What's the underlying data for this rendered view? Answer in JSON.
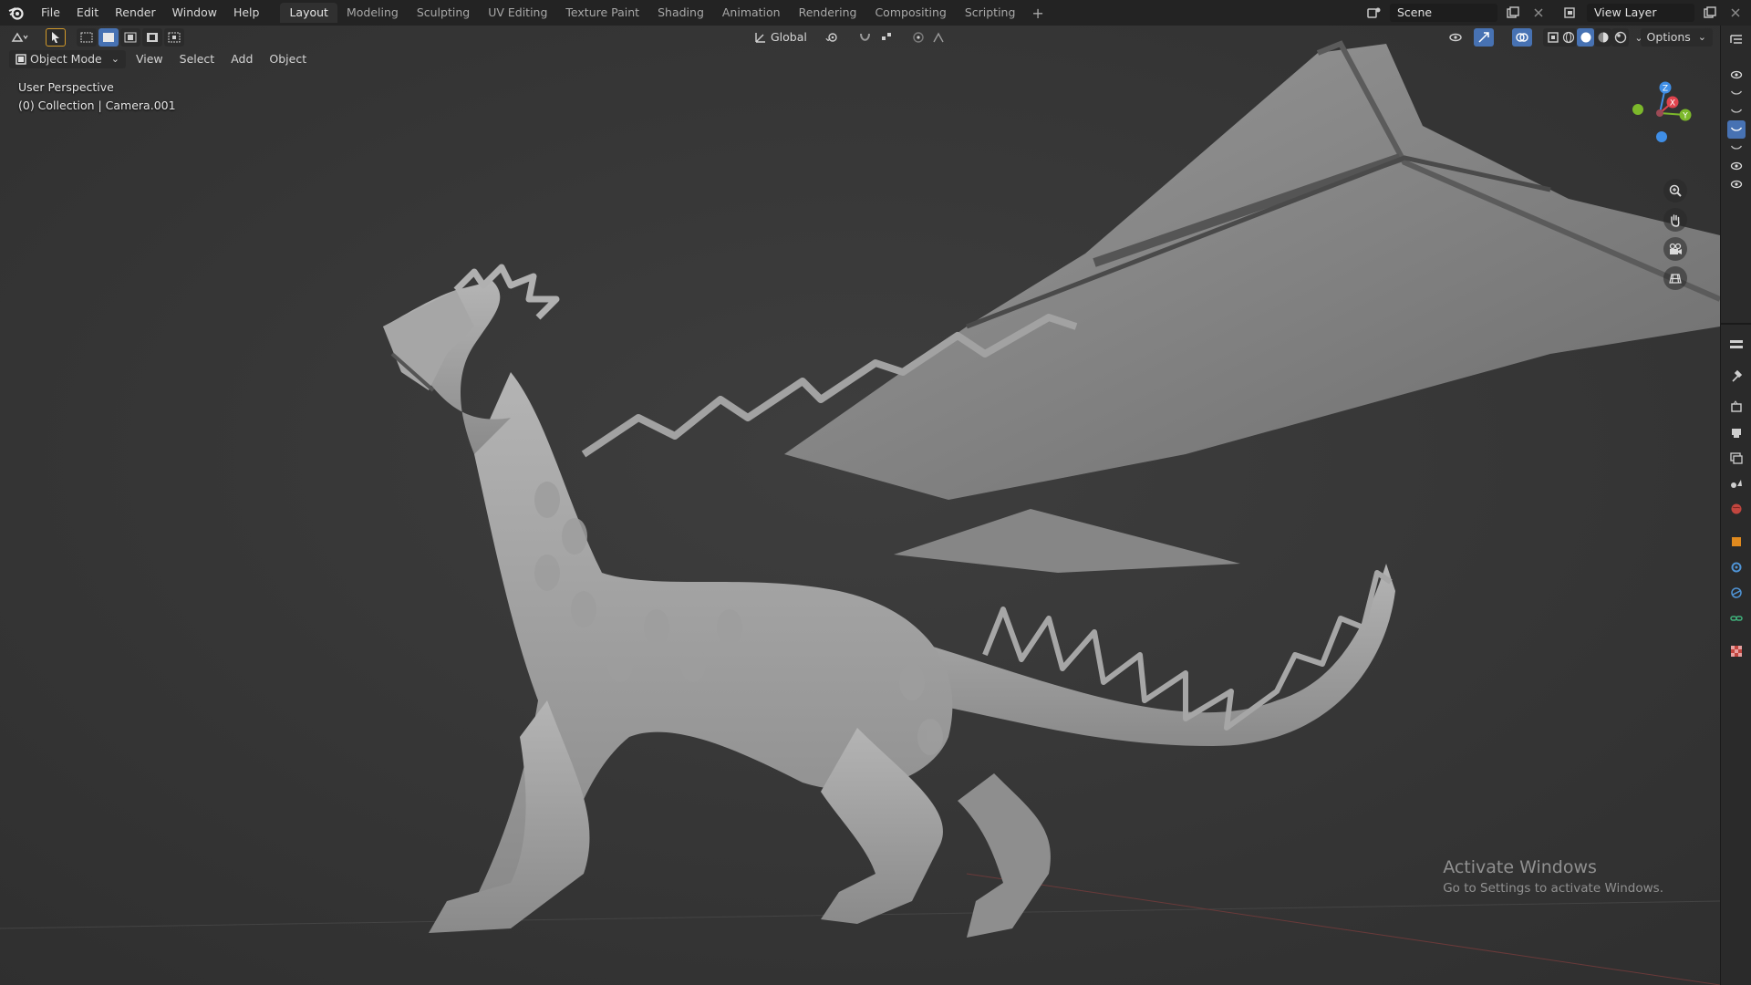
{
  "menu": {
    "items": [
      "File",
      "Edit",
      "Render",
      "Window",
      "Help"
    ]
  },
  "workspaces": {
    "tabs": [
      "Layout",
      "Modeling",
      "Sculpting",
      "UV Editing",
      "Texture Paint",
      "Shading",
      "Animation",
      "Rendering",
      "Compositing",
      "Scripting"
    ],
    "active": "Layout",
    "add_label": "+"
  },
  "scene": {
    "name": "Scene"
  },
  "view_layer": {
    "name": "View Layer"
  },
  "toolbar": {
    "transform_orientation": "Global",
    "options_label": "Options"
  },
  "viewport_header": {
    "mode": "Object Mode",
    "menus": [
      "View",
      "Select",
      "Add",
      "Object"
    ]
  },
  "viewport": {
    "perspective_label": "User Perspective",
    "collection_label": "(0) Collection | Camera.001"
  },
  "gizmo": {
    "x": "X",
    "y": "Y",
    "z": "Z"
  },
  "watermark": {
    "title": "Activate Windows",
    "subtitle": "Go to Settings to activate Windows."
  },
  "colors": {
    "accent": "#4772b3",
    "axis_x": "#e0444e",
    "axis_y": "#7cb82b",
    "axis_z": "#3f8ee6"
  }
}
